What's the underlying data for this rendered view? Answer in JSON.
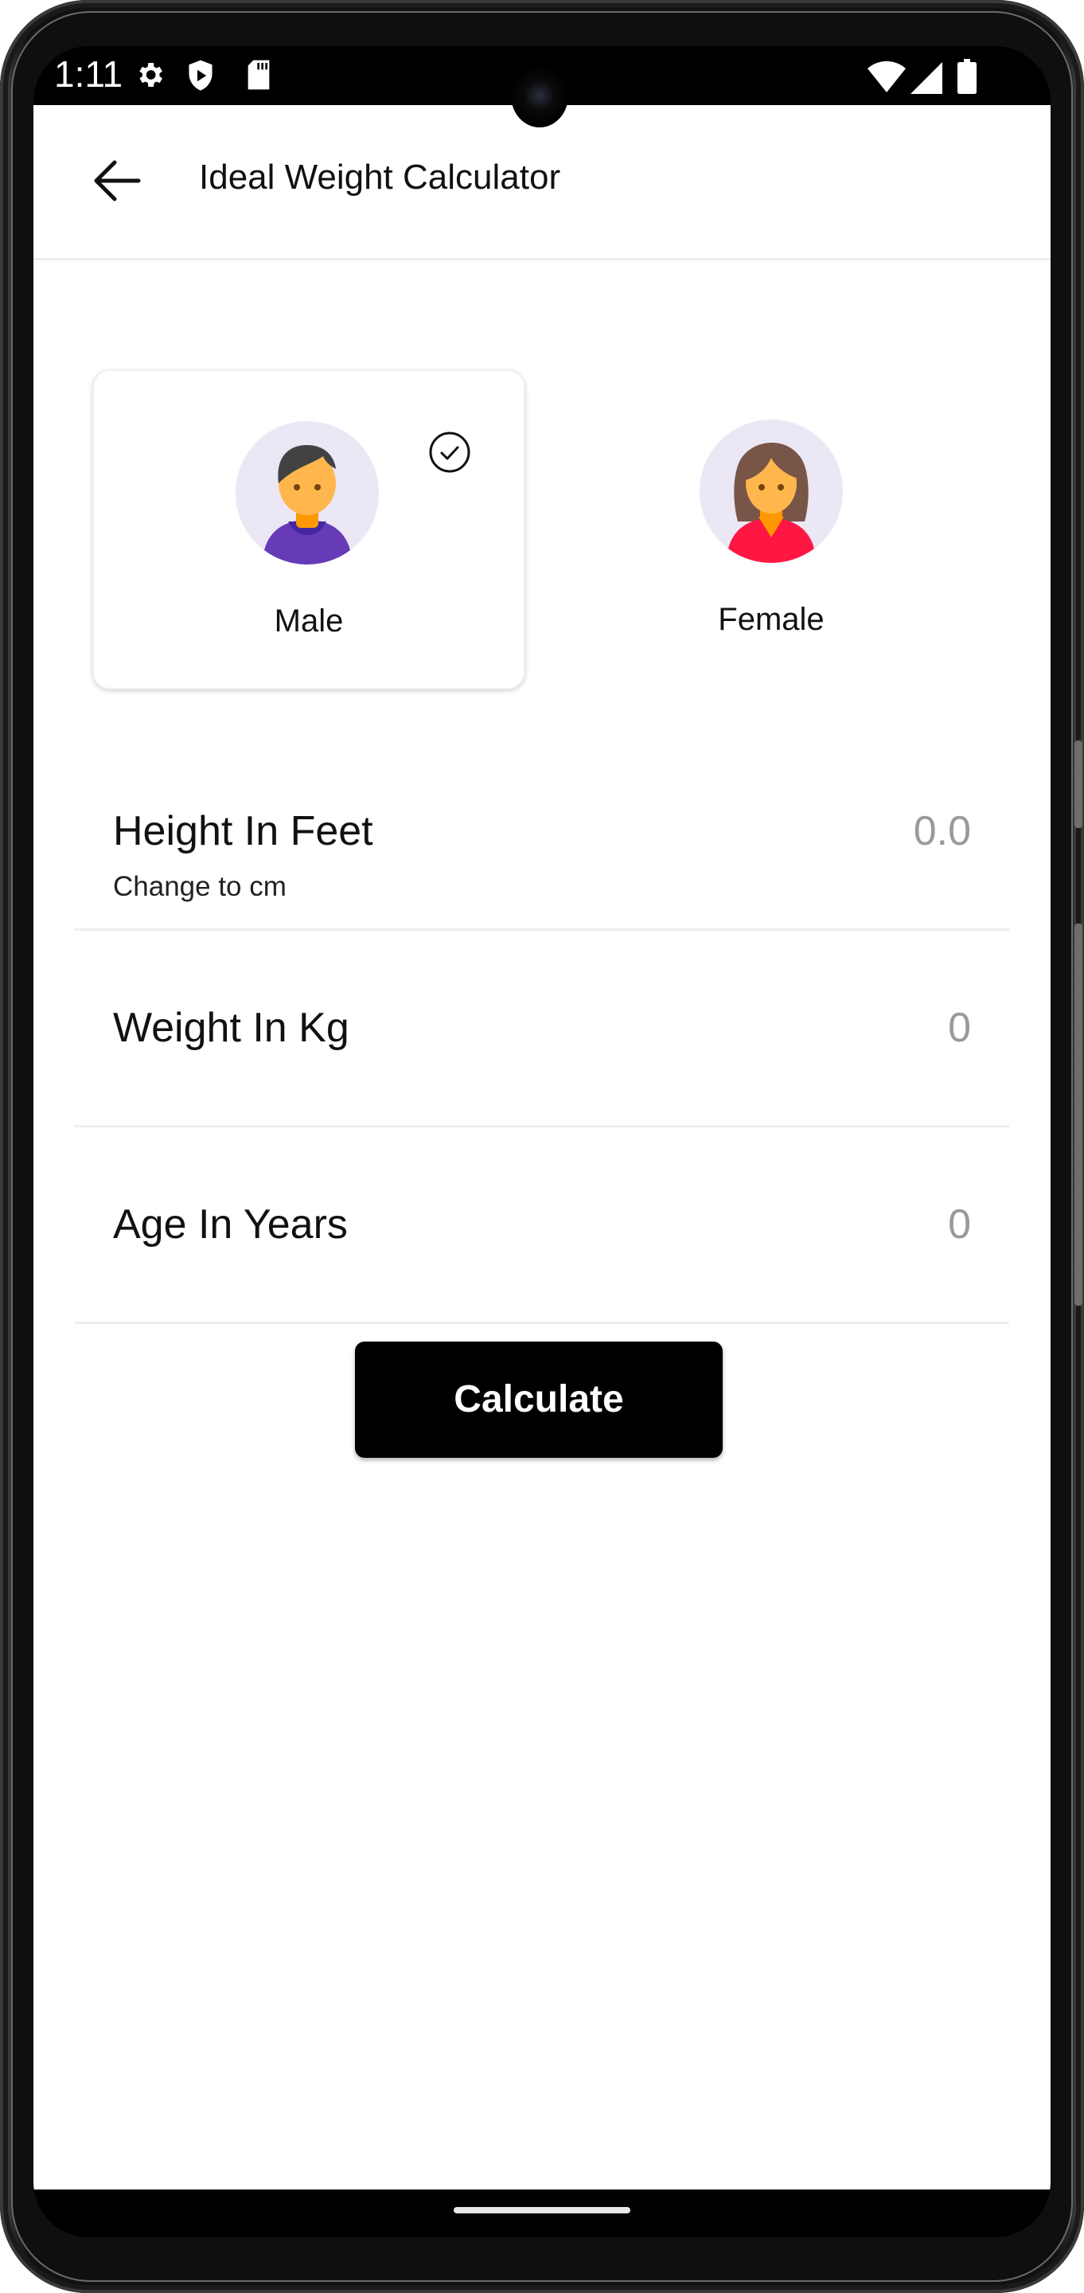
{
  "status_bar": {
    "time": "1:11",
    "left_icons": [
      "settings-icon",
      "play-protect-icon",
      "sd-card-icon"
    ],
    "right_icons": [
      "wifi-icon",
      "signal-icon",
      "battery-icon"
    ]
  },
  "app_bar": {
    "back_icon": "arrow-left-icon",
    "title": "Ideal Weight Calculator"
  },
  "gender": {
    "selected": "Male",
    "options": [
      {
        "label": "Male",
        "icon": "male-avatar-icon",
        "selected": true,
        "colors": {
          "shirt": "#673AB7",
          "hair": "#424242",
          "skin": "#FFB74D",
          "bg": "#EBE7F5"
        }
      },
      {
        "label": "Female",
        "icon": "female-avatar-icon",
        "selected": false,
        "colors": {
          "shirt": "#FF1744",
          "hair": "#795548",
          "skin": "#FFB74D",
          "bg": "#EBE7F5"
        }
      }
    ]
  },
  "fields": [
    {
      "label": "Height In Feet",
      "value": "0.0",
      "sub_link": "Change to cm"
    },
    {
      "label": "Weight In Kg",
      "value": "0"
    },
    {
      "label": "Age In Years",
      "value": "0"
    }
  ],
  "actions": {
    "calculate_label": "Calculate"
  },
  "theme": {
    "primary": "#000000",
    "value_gray": "#9A9A9A",
    "divider": "#EEEEEE"
  }
}
